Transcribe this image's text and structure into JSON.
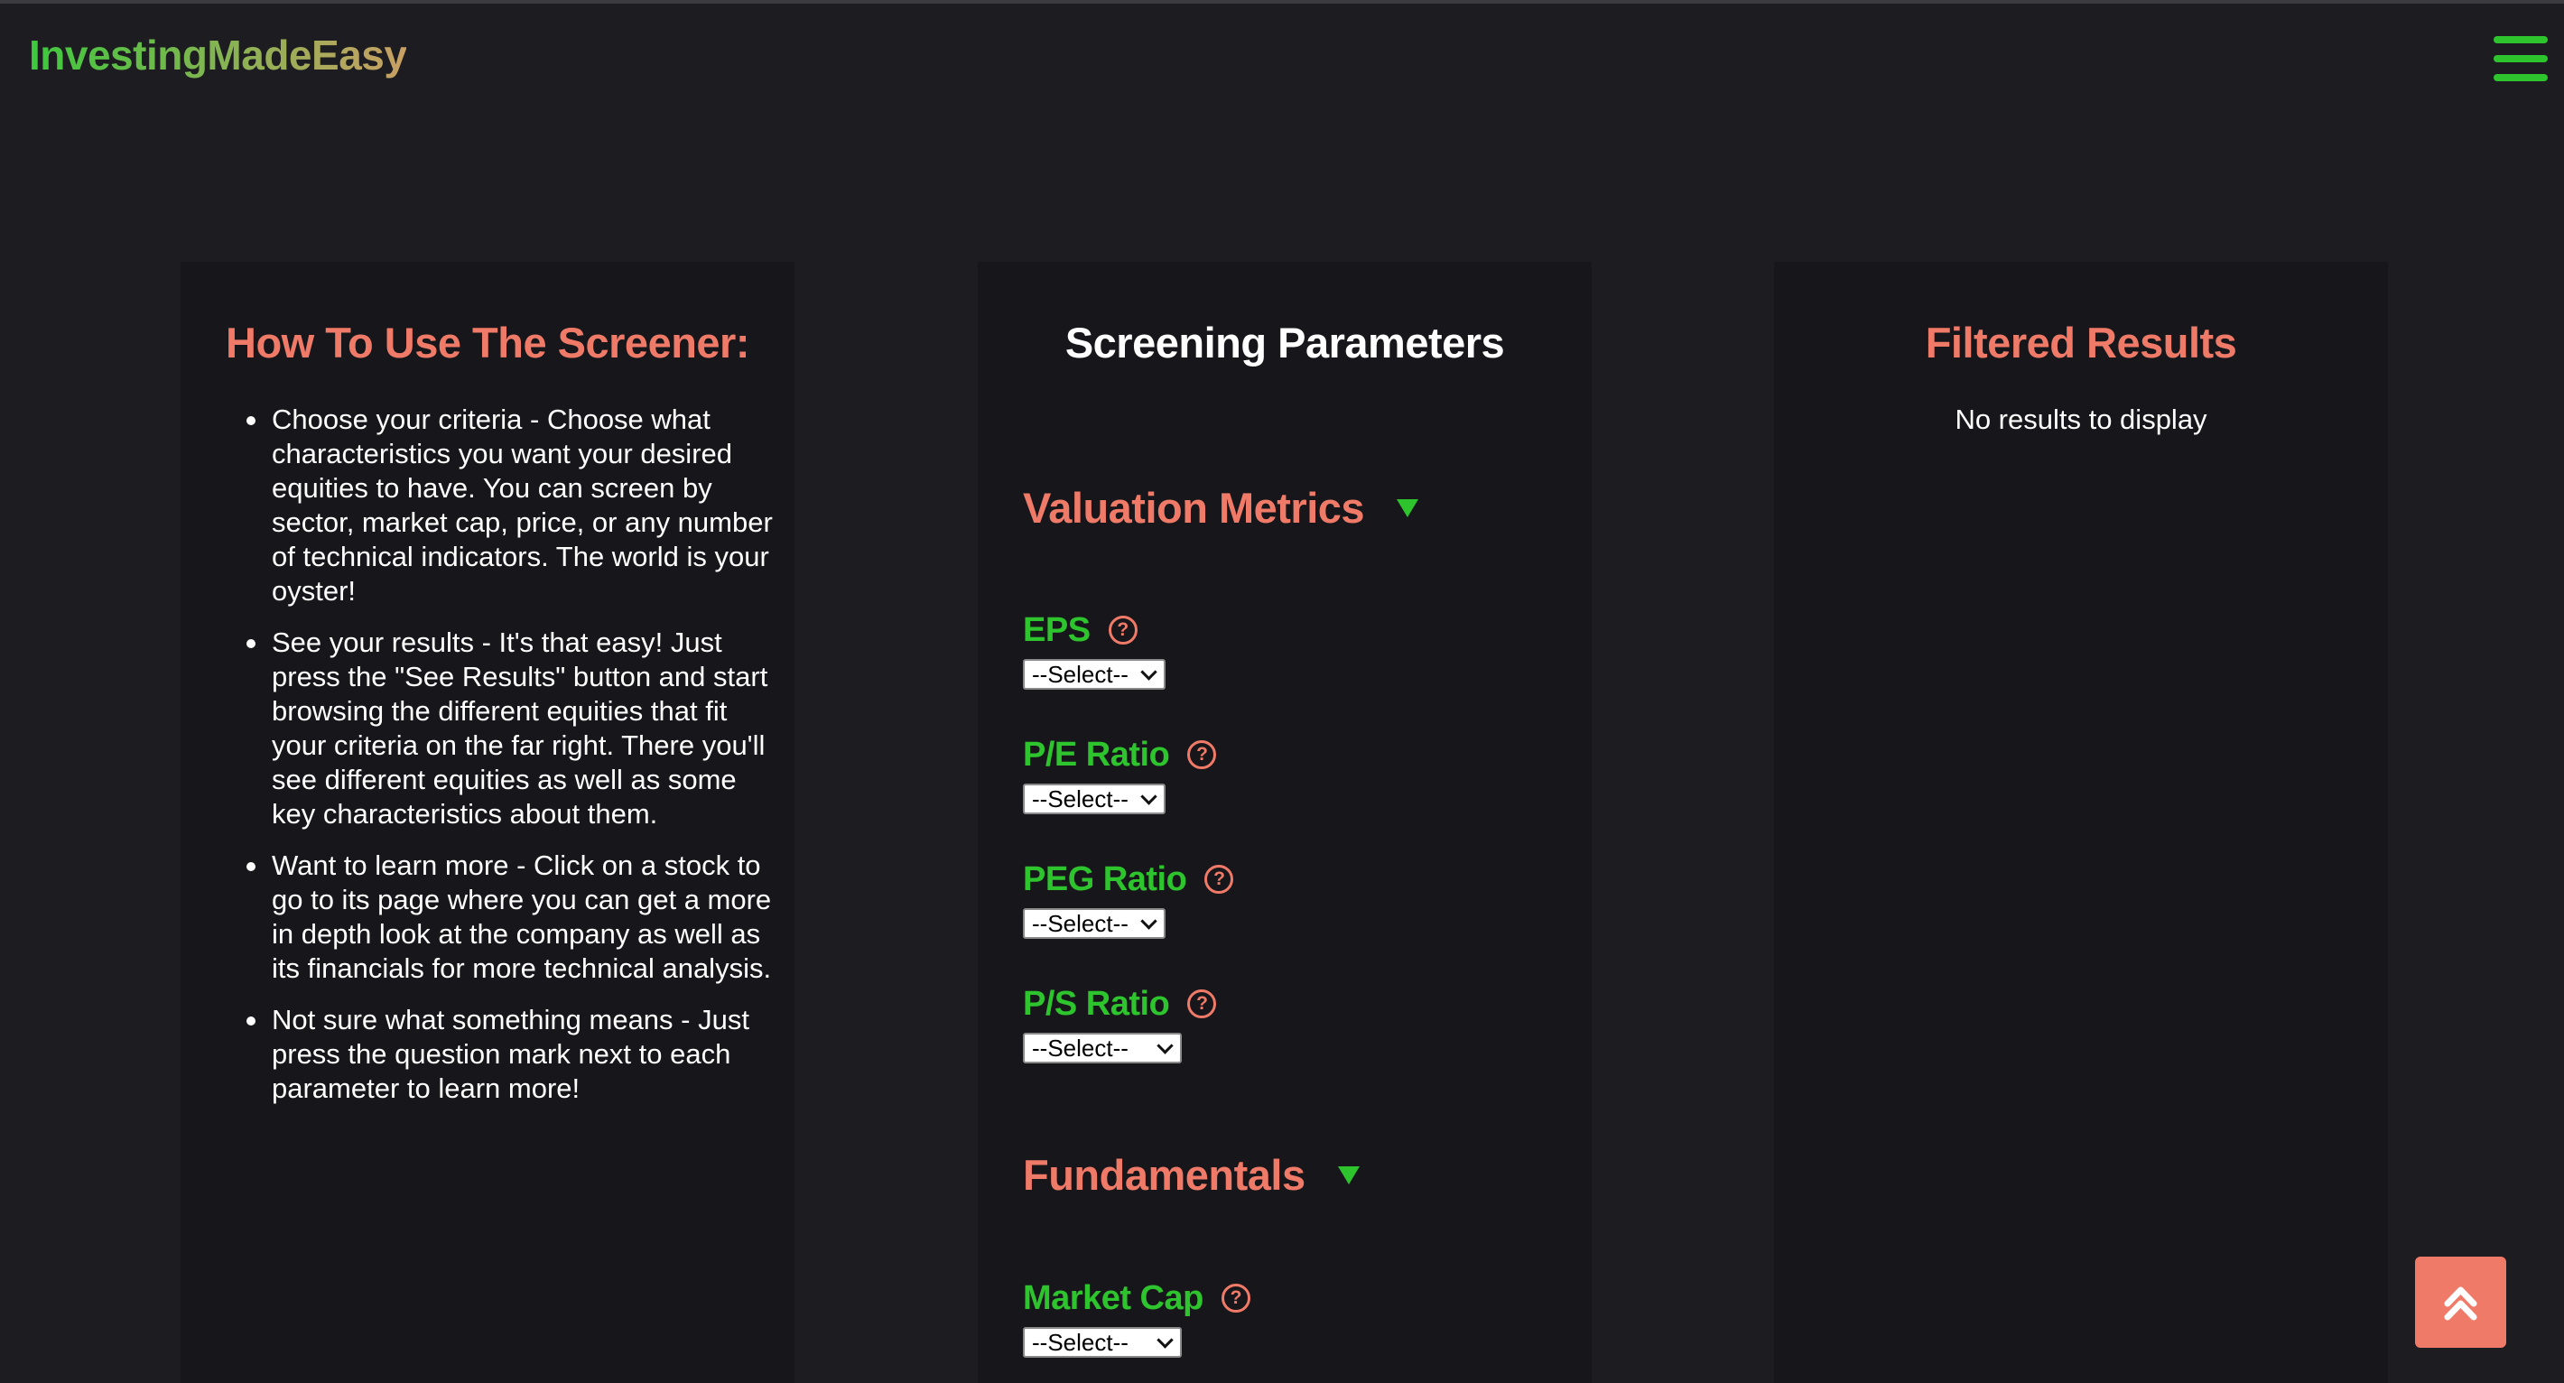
{
  "brand": {
    "name": "InvestingMadeEasy"
  },
  "nav": {
    "menu_icon": "hamburger-menu-icon"
  },
  "how_to": {
    "title": "How To Use The Screener:",
    "items": [
      "Choose your criteria - Choose what characteristics you want your desired equities to have. You can screen by sector, market cap, price, or any number of technical indicators. The world is your oyster!",
      "See your results - It's that easy! Just press the \"See Results\" button and start browsing the different equities that fit your criteria on the far right. There you'll see different equities as well as some key characteristics about them.",
      "Want to learn more - Click on a stock to go to its page where you can get a more in depth look at the company as well as its financials for more technical analysis.",
      "Not sure what something means - Just press the question mark next to each parameter to learn more!"
    ]
  },
  "screening": {
    "title": "Screening Parameters",
    "sections": [
      {
        "title": "Valuation Metrics",
        "expanded": true,
        "params": [
          {
            "label": "EPS",
            "select": "--Select--"
          },
          {
            "label": "P/E Ratio",
            "select": "--Select--"
          },
          {
            "label": "PEG Ratio",
            "select": "--Select--"
          },
          {
            "label": "P/S Ratio",
            "select": "--Select--"
          }
        ]
      },
      {
        "title": "Fundamentals",
        "expanded": true,
        "params": [
          {
            "label": "Market Cap",
            "select": "--Select--"
          }
        ]
      }
    ],
    "help_glyph": "?"
  },
  "results": {
    "title": "Filtered Results",
    "empty_text": "No results to display"
  },
  "scroll_top": {
    "icon": "double-chevron-up-icon"
  },
  "colors": {
    "background": "#1d1d21",
    "panel": "#17171b",
    "accent_salmon": "#f07a68",
    "accent_green": "#2ec42e"
  }
}
